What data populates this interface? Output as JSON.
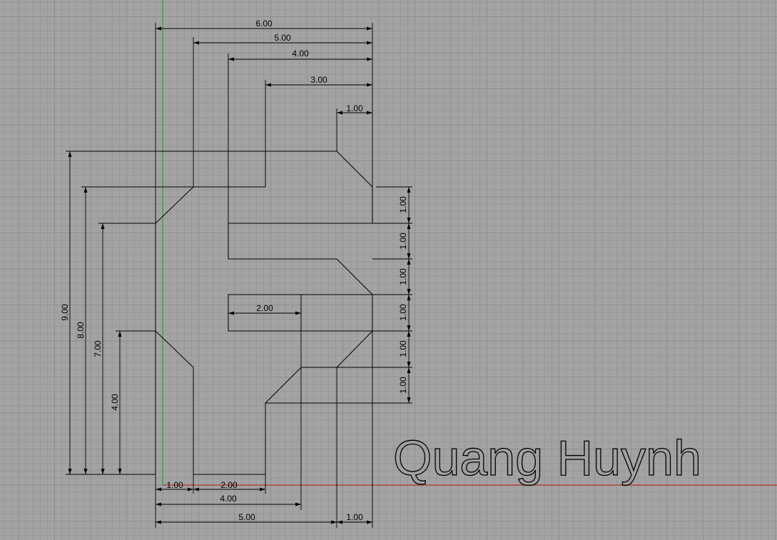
{
  "drawing": {
    "signature": "Quang Huynh",
    "colors": {
      "background": "#a3a3a3",
      "grid": "#989898",
      "x_axis": "#b52f2f",
      "y_axis": "#22a82a",
      "lines": "#000000"
    }
  },
  "dimensions": {
    "top": [
      "6.00",
      "5.00",
      "4.00",
      "3.00",
      "1.00"
    ],
    "left": [
      "9.00",
      "8.00",
      "7.00",
      "4.00"
    ],
    "right": [
      "1.00",
      "1.00",
      "1.00",
      "1.00",
      "1.00",
      "1.00"
    ],
    "bottom": [
      "1.00",
      "2.00",
      "4.00",
      "5.00",
      "1.00"
    ],
    "slot": "2.00"
  }
}
